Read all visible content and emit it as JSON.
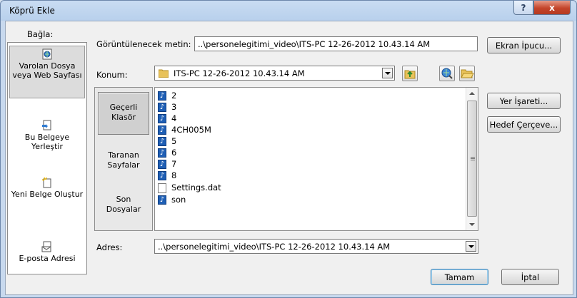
{
  "window": {
    "title": "Köprü Ekle",
    "help_label": "?",
    "close_label": "x"
  },
  "link_to": {
    "label": "Bağla:",
    "items": [
      {
        "label": "Varolan Dosya veya Web Sayfası",
        "icon": "web-page-icon",
        "active": true
      },
      {
        "label": "Bu Belgeye Yerleştir",
        "icon": "place-in-document-icon",
        "active": false
      },
      {
        "label": "Yeni Belge Oluştur",
        "icon": "new-document-icon",
        "active": false
      },
      {
        "label": "E-posta Adresi",
        "icon": "email-icon",
        "active": false
      }
    ]
  },
  "display_text": {
    "label": "Görüntülenecek metin:",
    "value": "..\\personelegitimi_video\\ITS-PC 12-26-2012 10.43.14 AM"
  },
  "screen_tip_button": "Ekran İpucu...",
  "look_in": {
    "label": "Konum:",
    "value": "ITS-PC 12-26-2012 10.43.14 AM"
  },
  "browse_tabs": [
    {
      "label": "Geçerli Klasör",
      "active": true
    },
    {
      "label": "Taranan Sayfalar",
      "active": false
    },
    {
      "label": "Son Dosyalar",
      "active": false
    }
  ],
  "files": [
    {
      "name": "2",
      "type": "audio"
    },
    {
      "name": "3",
      "type": "audio"
    },
    {
      "name": "4",
      "type": "audio"
    },
    {
      "name": "4CH005M",
      "type": "audio"
    },
    {
      "name": "5",
      "type": "audio"
    },
    {
      "name": "6",
      "type": "audio"
    },
    {
      "name": "7",
      "type": "audio"
    },
    {
      "name": "8",
      "type": "audio"
    },
    {
      "name": "Settings.dat",
      "type": "file"
    },
    {
      "name": "son",
      "type": "audio"
    }
  ],
  "bookmark_button": "Yer İşareti...",
  "target_frame_button": "Hedef Çerçeve...",
  "address": {
    "label": "Adres:",
    "value": "..\\personelegitimi_video\\ITS-PC 12-26-2012 10.43.14 AM"
  },
  "ok_button": "Tamam",
  "cancel_button": "İptal"
}
